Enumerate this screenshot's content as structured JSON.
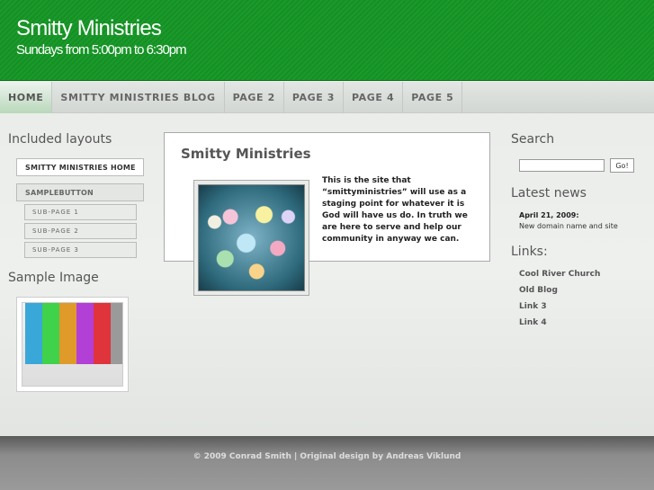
{
  "header": {
    "title": "Smitty Ministries",
    "tagline": "Sundays from 5:00pm to 6:30pm",
    "color": "#1a9a2a"
  },
  "nav": {
    "items": [
      {
        "label": "HOME",
        "active": true
      },
      {
        "label": "SMITTY MINISTRIES BLOG"
      },
      {
        "label": "PAGE 2"
      },
      {
        "label": "PAGE 3"
      },
      {
        "label": "PAGE 4"
      },
      {
        "label": "PAGE 5"
      }
    ]
  },
  "left": {
    "layouts_heading": "Included layouts",
    "layout_buttons": [
      "SMITTY MINISTRIES HOME",
      "SAMPLEBUTTON"
    ],
    "sub_pages": [
      "SUB-PAGE 1",
      "SUB-PAGE 2",
      "SUB-PAGE 3"
    ],
    "sample_heading": "Sample Image",
    "palette_colors": [
      "#3aa7d9",
      "#3fd24a",
      "#e09a2a",
      "#b23fd6",
      "#e0343c",
      "#9a9a9a"
    ]
  },
  "main": {
    "title": "Smitty Ministries",
    "body": "This is the site that “smittyministries” will use as a staging point for whatever it is God will have us do. In truth we are here to serve and help our community in anyway we can."
  },
  "right": {
    "search_heading": "Search",
    "search_button": "Go!",
    "news_heading": "Latest news",
    "news_date": "April 21, 2009:",
    "news_text": "New domain name and site",
    "links_heading": "Links:",
    "links": [
      "Cool River Church",
      "Old Blog",
      "Link 3",
      "Link 4"
    ]
  },
  "footer": {
    "text": "© 2009 Conrad Smith | Original design by Andreas Viklund"
  }
}
